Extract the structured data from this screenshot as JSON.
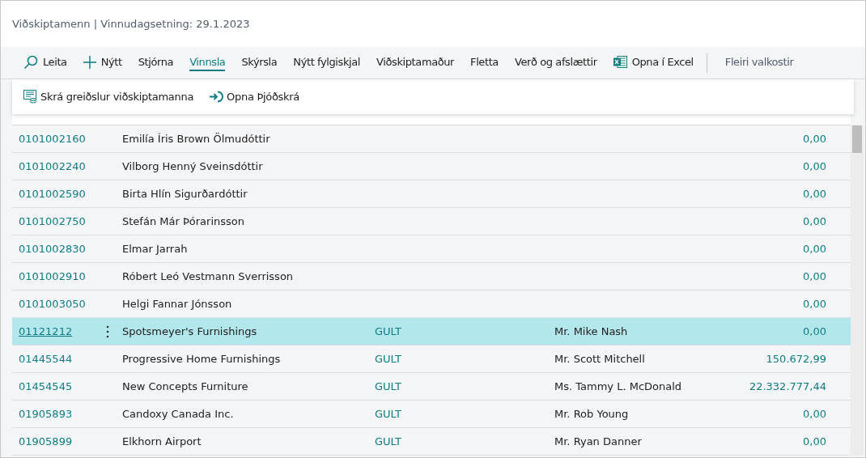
{
  "page_title": "Viðskiptamenn | Vinnudagsetning: 29.1.2023",
  "toolbar": [
    {
      "kind": "search",
      "label": "Leita",
      "selected": false
    },
    {
      "kind": "new",
      "label": "Nýtt",
      "selected": false
    },
    {
      "kind": "menu",
      "label": "Stjórna",
      "selected": false
    },
    {
      "kind": "menu",
      "label": "Vinnsla",
      "selected": true
    },
    {
      "kind": "menu",
      "label": "Skýrsla",
      "selected": false
    },
    {
      "kind": "menu",
      "label": "Nýtt fylgiskjal",
      "selected": false
    },
    {
      "kind": "menu",
      "label": "Viðskiptamaður",
      "selected": false
    },
    {
      "kind": "menu",
      "label": "Fletta",
      "selected": false
    },
    {
      "kind": "menu",
      "label": "Verð og afslættir",
      "selected": false
    },
    {
      "kind": "excel",
      "label": "Opna í Excel",
      "selected": false
    }
  ],
  "more_options": "Fleiri valkostir",
  "action_menu": [
    {
      "kind": "payments",
      "label": "Skrá greiðslur viðskiptamanna"
    },
    {
      "kind": "open",
      "label": "Opna Þjóðskrá"
    }
  ],
  "rows": [
    {
      "no": "0101002160",
      "name": "Emilía Íris Brown Ölmudóttir",
      "balance": "0,00",
      "selected": false
    },
    {
      "no": "0101002240",
      "name": "Vilborg Henný Sveinsdóttir",
      "balance": "0,00",
      "selected": false
    },
    {
      "no": "0101002590",
      "name": "Birta Hlín Sigurðardóttir",
      "balance": "0,00",
      "selected": false
    },
    {
      "no": "0101002750",
      "name": "Stefán Már Þórarinsson",
      "balance": "0,00",
      "selected": false
    },
    {
      "no": "0101002830",
      "name": "Elmar Jarrah",
      "balance": "0,00",
      "selected": false
    },
    {
      "no": "0101002910",
      "name": "Róbert Leó Vestmann Sverrisson",
      "balance": "0,00",
      "selected": false
    },
    {
      "no": "0101003050",
      "name": "Helgi Fannar Jónsson",
      "balance": "0,00",
      "selected": false
    },
    {
      "no": "01121212",
      "name": "Spotsmeyer's Furnishings",
      "group": "GULT",
      "contact": "Mr. Mike Nash",
      "balance": "0,00",
      "selected": true
    },
    {
      "no": "01445544",
      "name": "Progressive Home Furnishings",
      "group": "GULT",
      "contact": "Mr. Scott Mitchell",
      "balance": "150.672,99",
      "selected": false
    },
    {
      "no": "01454545",
      "name": "New Concepts Furniture",
      "group": "GULT",
      "contact": "Ms. Tammy L. McDonald",
      "balance": "22.332.777,44",
      "selected": false
    },
    {
      "no": "01905893",
      "name": "Candoxy Canada Inc.",
      "group": "GULT",
      "contact": "Mr. Rob Young",
      "balance": "0,00",
      "selected": false
    },
    {
      "no": "01905899",
      "name": "Elkhorn Airport",
      "group": "GULT",
      "contact": "Mr. Ryan Danner",
      "balance": "0,00",
      "selected": false
    }
  ]
}
